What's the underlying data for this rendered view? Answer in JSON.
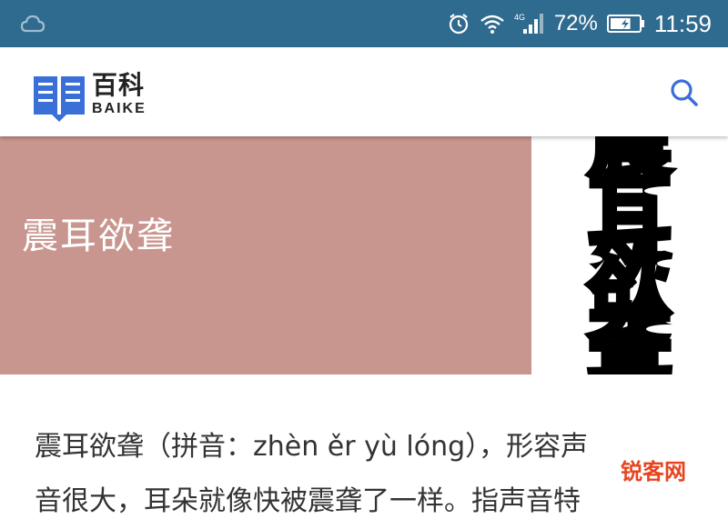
{
  "status_bar": {
    "left_icon": "cloud-icon",
    "network": "4G",
    "battery_percent": "72%",
    "battery_level": 0.72,
    "time": "11:59",
    "background_color": "#2f6a8f"
  },
  "header": {
    "logo_cn": "百科",
    "logo_en": "BAIKE",
    "logo_color": "#3b6fd8",
    "search_icon": "search-icon",
    "search_color": "#3b6fd8"
  },
  "hero": {
    "title": "震耳欲聋",
    "banner_color": "#c9968f",
    "image_chars": [
      "震",
      "耳",
      "欲",
      "聋"
    ]
  },
  "article": {
    "line1": "震耳欲聋（拼音：zhèn ěr yù lóng），形容声",
    "line2": "音很大，耳朵就像快被震聋了一样。指声音特"
  },
  "watermark": {
    "text": "锐客网",
    "color": "#e8431e"
  }
}
